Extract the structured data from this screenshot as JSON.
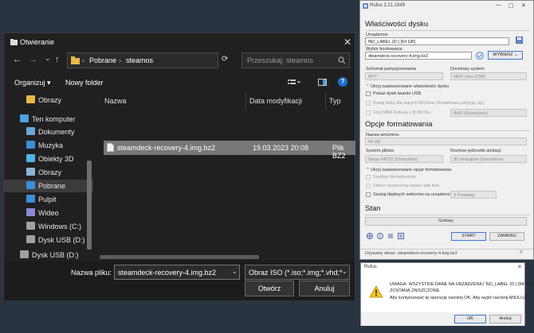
{
  "open_dialog": {
    "title": "Otwieranie",
    "close": "✕",
    "nav": {
      "back": "←",
      "forward": "→",
      "dropdown": "⌄",
      "up": "↑"
    },
    "path": [
      "Pobrane",
      "steamos"
    ],
    "path_sep": "›",
    "refresh": "⟳",
    "search_placeholder": "Przeszukaj: steamos",
    "toolbar": {
      "organize": "Organizuj",
      "new_folder": "Nowy folder",
      "help": "?"
    },
    "sidebar": [
      {
        "label": "Obrazy",
        "icon": "folder-icon",
        "color": "#e8b84a"
      },
      {
        "label": "Ten komputer",
        "icon": "computer-icon",
        "color": "#4aa3df"
      },
      {
        "label": "Dokumenty",
        "icon": "document-icon",
        "color": "#6aa6d8"
      },
      {
        "label": "Muzyka",
        "icon": "music-icon",
        "color": "#3a8fd6"
      },
      {
        "label": "Obiekty 3D",
        "icon": "cube-icon",
        "color": "#4fb6e8"
      },
      {
        "label": "Obrazy",
        "icon": "picture-icon",
        "color": "#8ab4d8"
      },
      {
        "label": "Pobrane",
        "icon": "download-icon",
        "color": "#3a8fd6",
        "selected": true
      },
      {
        "label": "Pulpit",
        "icon": "desktop-icon",
        "color": "#3a8fd6"
      },
      {
        "label": "Wideo",
        "icon": "video-icon",
        "color": "#8a8ad8"
      },
      {
        "label": "Windows (C:)",
        "icon": "drive-icon",
        "color": "#a0a0a0"
      },
      {
        "label": "Dysk USB (D:)",
        "icon": "usb-drive-icon",
        "color": "#a0a0a0"
      },
      {
        "label": "Dysk USB (D:)",
        "icon": "usb-drive-icon",
        "color": "#a0a0a0"
      }
    ],
    "columns": {
      "name": "Nazwa",
      "date": "Data modyfikacji",
      "type": "Typ"
    },
    "files": [
      {
        "name": "steamdeck-recovery-4.img.bz2",
        "date": "19.03.2023 20:08",
        "type": "Plik BZ2"
      }
    ],
    "filename_label": "Nazwa pliku:",
    "filename_value": "steamdeck-recovery-4.img.bz2",
    "filetype_value": "Obraz ISO (*.iso;*.img;*.vhd;*.usb",
    "open_button": "Otwórz",
    "cancel_button": "Anuluj"
  },
  "rufus": {
    "title": "Rufus 3.21.1949",
    "window_buttons": [
      "—",
      "▢",
      "✕"
    ],
    "section_drive": "Właściwości dysku",
    "device_label": "Urządzenie",
    "device_value": "NO_LABEL (D:) [64 GB]",
    "boot_label": "Wybór bootowania",
    "boot_value": "steamdeck-recovery-4.img.bz2",
    "select_button": "WYBIERZ",
    "partition_label": "Schemat partycjonowania",
    "partition_value": "GPT",
    "target_label": "Docelowy system",
    "target_value": "UEFI (bez CSM)",
    "adv_drive": "Ukryj zaawansowane właściwości dysku",
    "list_usb": "Pokaż dyski twarde USB",
    "old_bios": "Dodaj łatkę dla starych BIOSów (dodatkowa partycja, itp.)",
    "mbr_bios": "Użyj MBR Rufusa z ID BIOSu",
    "mbr_value": "0x80 (Domyślnie)",
    "section_format": "Opcje formatowania",
    "volume_label": "Nazwa woluminu",
    "volume_value": "64 GB",
    "fs_label": "System plików",
    "fs_value": "Large FAT32 (Domyślnie)",
    "cluster_label": "Rozmiar jednostki alokacji",
    "cluster_value": "32 kilobajtów (Domyślnie)",
    "adv_format": "Ukryj zaawansowane opcje formatowania",
    "quick_format": "Szybkie formatowanie",
    "ext_label": "Utwórz rozszerzoną nazwę i pliki ikon",
    "bad_blocks": "Szukaj błędnych sektorów na urządzeniu",
    "passes_value": "1 Przebieg",
    "section_status": "Stan",
    "status_value": "Gotowy",
    "start_button": "START",
    "close_button": "ZAMKNIJ",
    "footer": "Używany obraz: steamdeck-recovery-4.img.bz2"
  },
  "warning": {
    "title": "Rufus",
    "close": "✕",
    "line1": "UWAGA: WSZYSTKIE DANE NA URZĄDZENIU 'NO_LABEL (D:) [64 GB]'",
    "line2": "ZOSTANĄ ZNISZCZONE.",
    "line3": "Aby kontynuować tę operację naciśnij OK. Aby wyjść naciśnij ANULUJ.",
    "ok_button": "OK",
    "cancel_button": "Anuluj"
  }
}
